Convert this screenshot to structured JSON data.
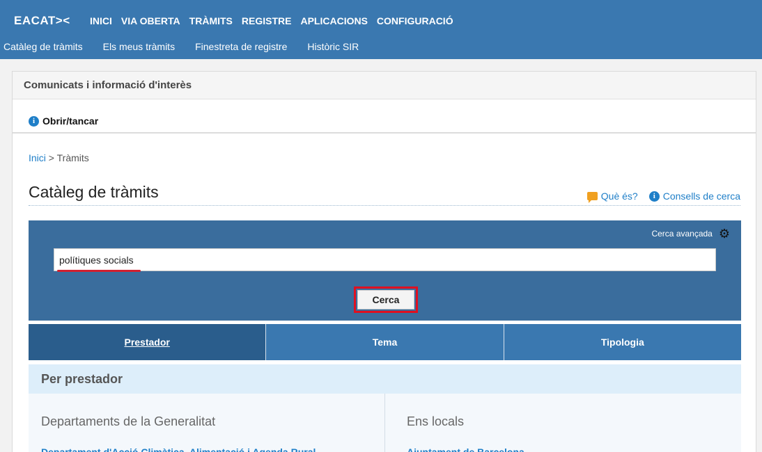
{
  "header": {
    "logo": "EACAT><",
    "main_nav": [
      "INICI",
      "VIA OBERTA",
      "TRÀMITS",
      "REGISTRE",
      "APLICACIONS",
      "CONFIGURACIÓ"
    ],
    "sub_nav": [
      "Catàleg de tràmits",
      "Els meus tràmits",
      "Finestreta de registre",
      "Històric SIR"
    ]
  },
  "notices": {
    "title": "Comunicats i informació d'interès",
    "toggle_label": "Obrir/tancar"
  },
  "breadcrumb": {
    "home": "Inici",
    "separator": ">",
    "current": "Tràmits"
  },
  "page": {
    "title": "Catàleg de tràmits",
    "what_is_link": "Què és?",
    "search_tips_link": "Consells de cerca"
  },
  "search": {
    "advanced_label": "Cerca avançada",
    "query_value": "polítiques socials",
    "button_label": "Cerca"
  },
  "tabs": [
    {
      "label": "Prestador",
      "active": true
    },
    {
      "label": "Tema",
      "active": false
    },
    {
      "label": "Tipologia",
      "active": false
    }
  ],
  "providers": {
    "heading": "Per prestador",
    "left_title": "Departaments de la Generalitat",
    "left_first_link": "Departament d'Acció Climàtica, Alimentació i Agenda Rural",
    "right_title": "Ens locals",
    "right_first_link": "Ajuntament de Barcelona"
  },
  "colors": {
    "header_blue": "#3a78b0",
    "panel_blue": "#3a6d9d",
    "active_tab": "#2a5d8c",
    "link_blue": "#1f7fc8",
    "highlight_red": "#e01020"
  }
}
